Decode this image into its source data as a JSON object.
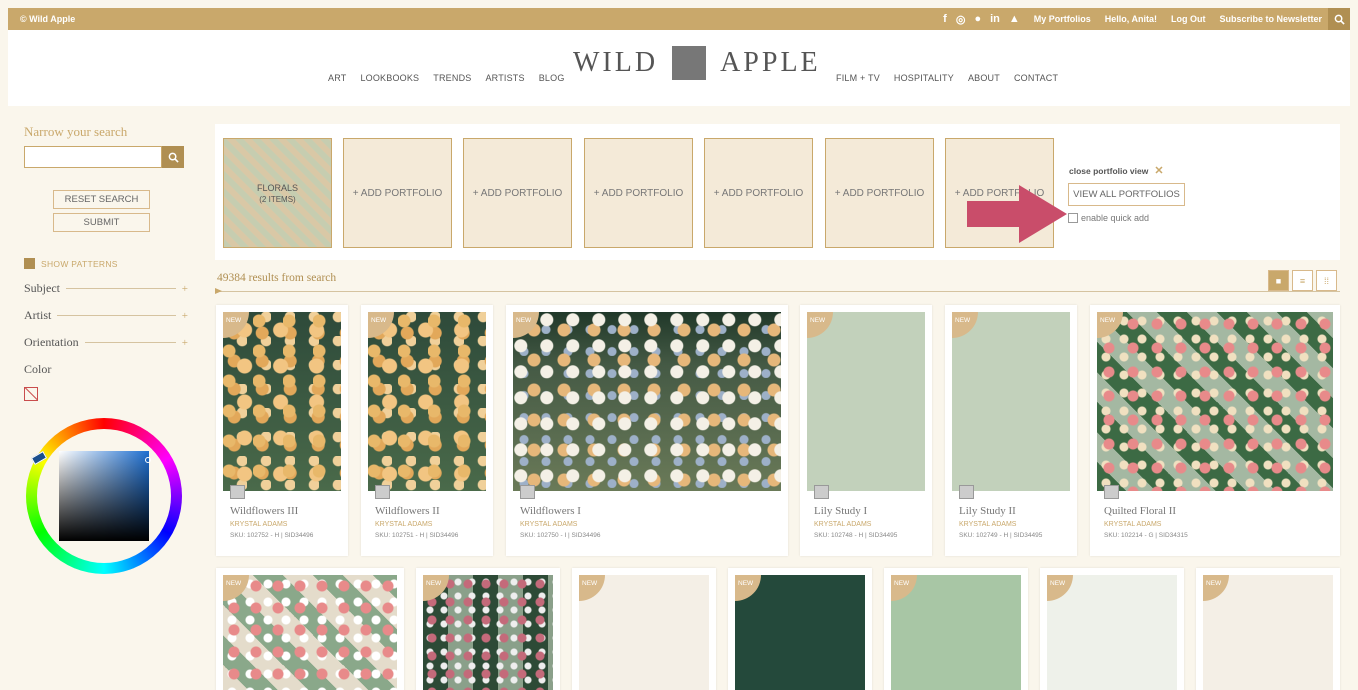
{
  "topbar": {
    "copyright": "© Wild Apple",
    "links": [
      "My Portfolios",
      "Hello, Anita!",
      "Log Out",
      "Subscribe to Newsletter"
    ]
  },
  "header": {
    "nav_left": [
      "ART",
      "LOOKBOOKS",
      "TRENDS",
      "ARTISTS",
      "BLOG"
    ],
    "logo_left": "WILD",
    "logo_right": "APPLE",
    "nav_right": [
      "FILM + TV",
      "HOSPITALITY",
      "ABOUT",
      "CONTACT"
    ]
  },
  "sidebar": {
    "narrow_title": "Narrow your search",
    "search_placeholder": "",
    "reset_label": "RESET SEARCH",
    "submit_label": "SUBMIT",
    "show_patterns": "SHOW PATTERNS",
    "facets": [
      "Subject",
      "Artist",
      "Orientation"
    ],
    "color_label": "Color"
  },
  "portfolio": {
    "first_name": "FLORALS",
    "first_count": "(2 ITEMS)",
    "add_label": "+ ADD PORTFOLIO",
    "close_label": "close portfolio view",
    "view_all_label": "VIEW ALL PORTFOLIOS",
    "quick_add_label": "enable quick add"
  },
  "results": {
    "count_text": "49384 results from search"
  },
  "badge": "NEW",
  "products": [
    {
      "title": "Wildflowers III",
      "artist": "KRYSTAL ADAMS",
      "sku": "SKU: 102752 - H | SID34496"
    },
    {
      "title": "Wildflowers II",
      "artist": "KRYSTAL ADAMS",
      "sku": "SKU: 102751 - H | SID34496"
    },
    {
      "title": "Wildflowers I",
      "artist": "KRYSTAL ADAMS",
      "sku": "SKU: 102750 - I | SID34496"
    },
    {
      "title": "Lily Study I",
      "artist": "KRYSTAL ADAMS",
      "sku": "SKU: 102748 - H | SID34495"
    },
    {
      "title": "Lily Study II",
      "artist": "KRYSTAL ADAMS",
      "sku": "SKU: 102749 - H | SID34495"
    },
    {
      "title": "Quilted Floral II",
      "artist": "KRYSTAL ADAMS",
      "sku": "SKU: 102214 - G | SID34315"
    }
  ],
  "colors": {
    "accent": "#c9a86b",
    "arrow": "#c94d6a"
  }
}
